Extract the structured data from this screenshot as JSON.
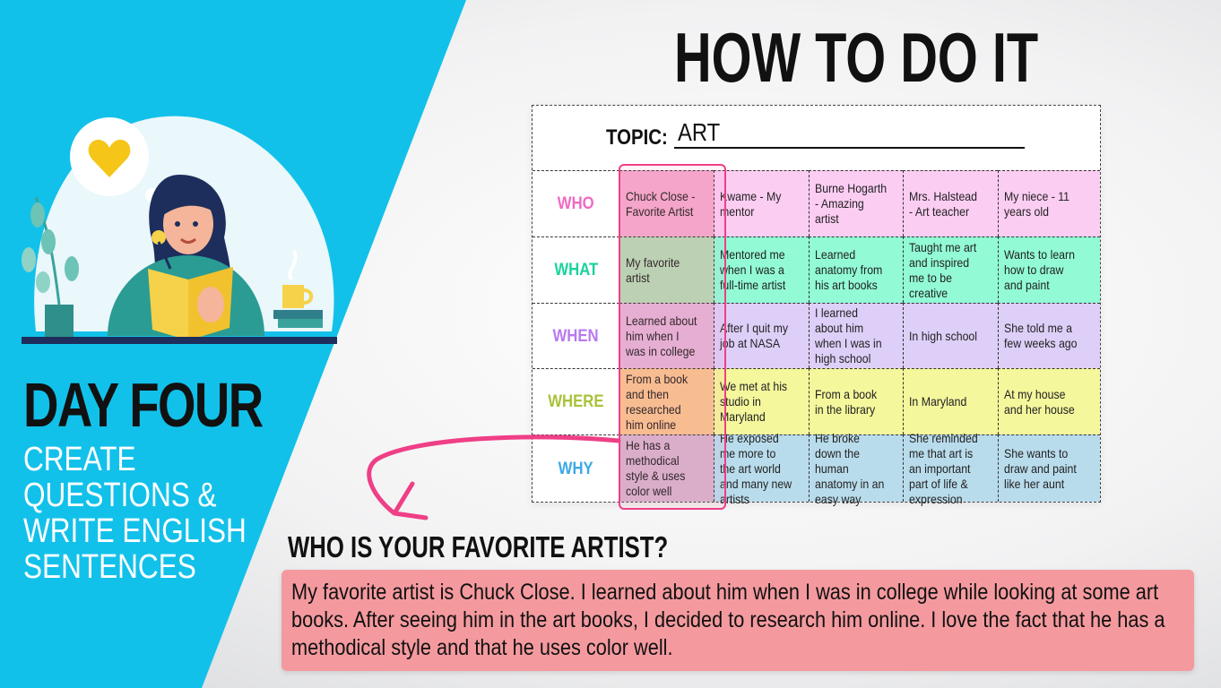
{
  "left_panel": {
    "day_title": "DAY FOUR",
    "subtitle_lines": [
      "CREATE",
      "QUESTIONS &",
      "WRITE ENGLISH",
      "SENTENCES"
    ]
  },
  "main_title": "HOW TO DO IT",
  "chart": {
    "topic_label": "TOPIC:",
    "topic_value": "ART",
    "rows": [
      {
        "label": "WHO",
        "label_color": "#f069c4",
        "cells": [
          "Chuck Close - Favorite Artist",
          "Kwame - My mentor",
          "Burne Hogarth - Amazing artist",
          "Mrs. Halstead - Art teacher",
          "My niece - 11 years old"
        ]
      },
      {
        "label": "WHAT",
        "label_color": "#19d39c",
        "cells": [
          "My favorite artist",
          "Mentored me when I was a full-time artist",
          "Learned anatomy from his art books",
          "Taught me art and inspired me to be creative",
          "Wants to learn how to draw and paint"
        ]
      },
      {
        "label": "WHEN",
        "label_color": "#b978f0",
        "cells": [
          "Learned about him when I was in college",
          "After I quit my job at NASA",
          "I learned about him when I was in high school",
          "In high school",
          "She told me a few weeks ago"
        ]
      },
      {
        "label": "WHERE",
        "label_color": "#a8c23a",
        "cells": [
          "From a book and then researched him online",
          "We met at his studio in Maryland",
          "From a book in the library",
          "In Maryland",
          "At my house and her house"
        ]
      },
      {
        "label": "WHY",
        "label_color": "#3ca8e6",
        "cells": [
          "He has a methodical style & uses color well",
          "He exposed me more to the art world and many new artists",
          "He broke down the human anatomy in an easy way",
          "She reminded me that art is an important part of life & expression",
          "She wants to draw and paint like her aunt"
        ]
      }
    ]
  },
  "question": "WHO IS YOUR FAVORITE ARTIST?",
  "answer": "My favorite artist is Chuck Close. I learned about him when I was in college while looking at some art books. After seeing him in the art books, I decided to research him online. I love the fact that he has a methodical style and that he uses color well.",
  "colors": {
    "cyan_panel": "#12c1ea",
    "highlight_border": "#ef3f86",
    "answer_box": "#f49a9f"
  },
  "icons": [
    "heart-icon",
    "woman-reading-illustration",
    "plant-icon",
    "coffee-cup-icon",
    "books-icon",
    "curved-arrow-icon"
  ]
}
